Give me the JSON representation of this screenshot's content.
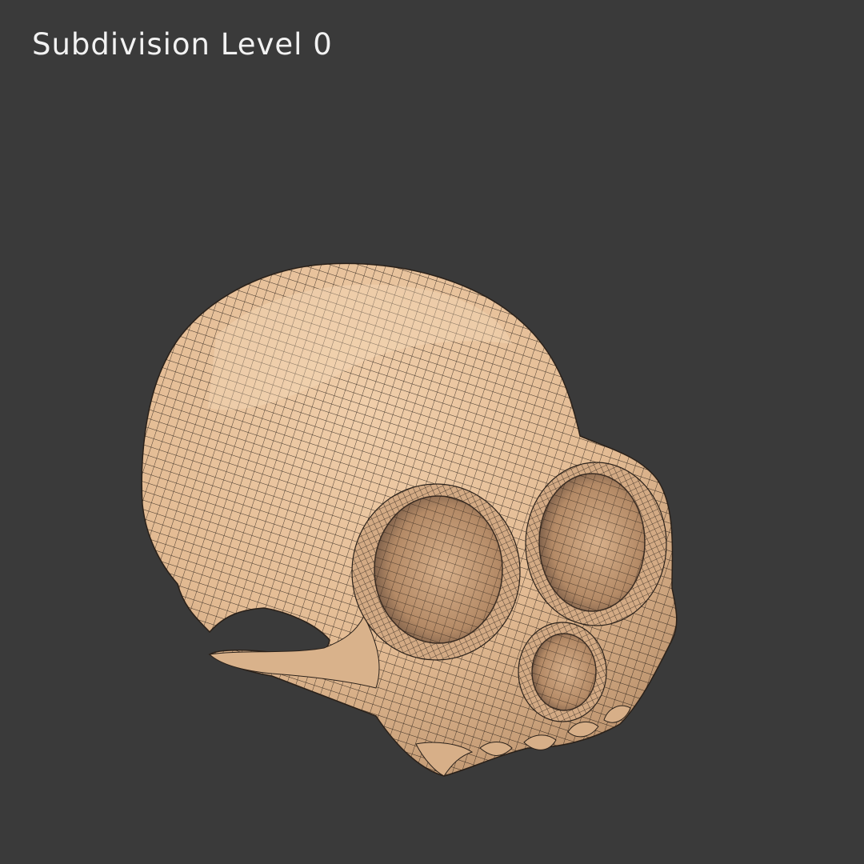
{
  "viewport": {
    "background_color": "#3a3a3a",
    "label": "Subdivision Level 0"
  },
  "model": {
    "subject": "skull-mesh",
    "surface_color": "#e6c09a",
    "wire_color": "#1e1712"
  }
}
